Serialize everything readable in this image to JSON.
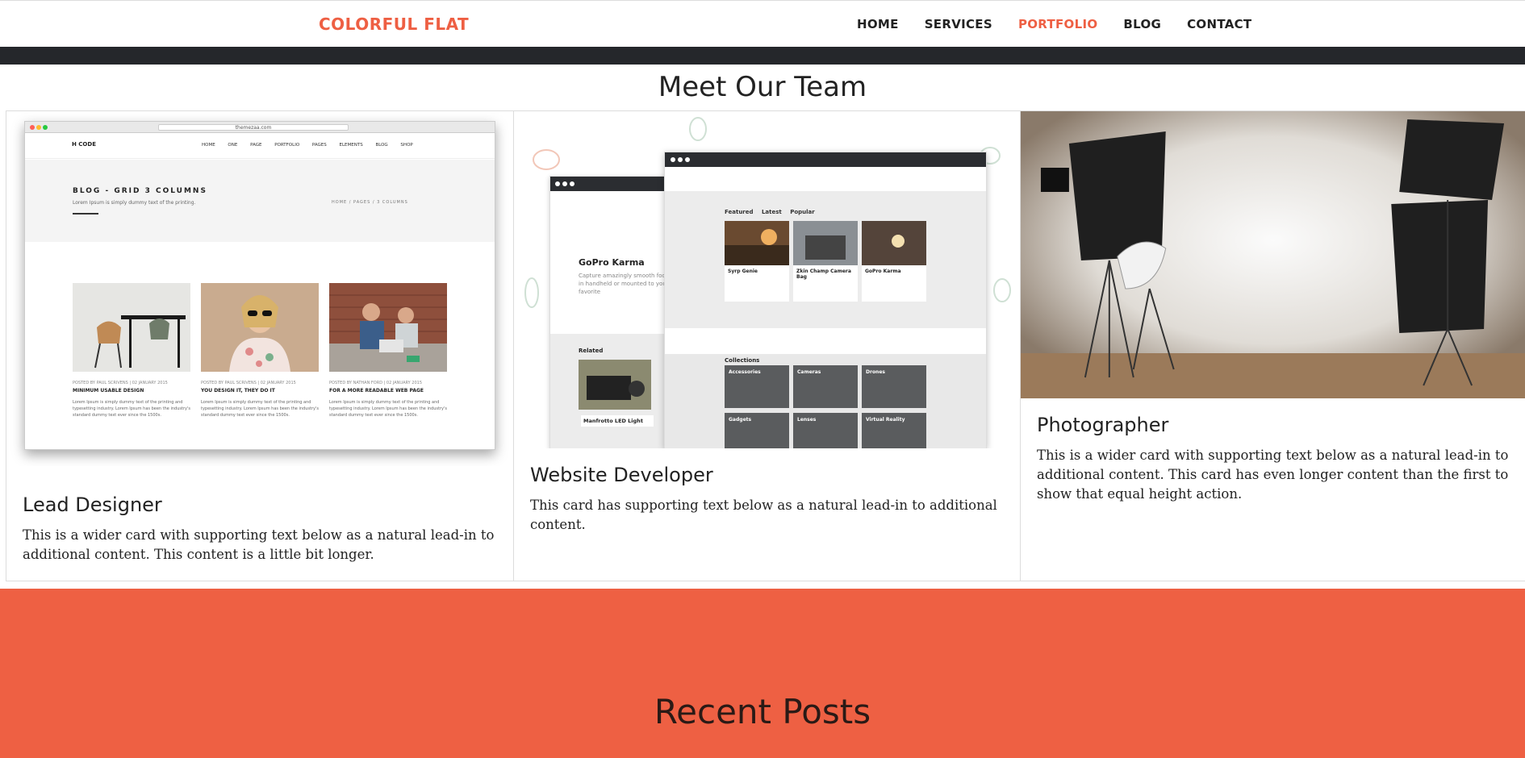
{
  "brand": "COLORFUL FLAT",
  "nav": {
    "items": [
      {
        "label": "HOME"
      },
      {
        "label": "SERVICES"
      },
      {
        "label": "PORTFOLIO"
      },
      {
        "label": "BLOG"
      },
      {
        "label": "CONTACT"
      }
    ],
    "active": "PORTFOLIO"
  },
  "team": {
    "title": "Meet Our Team",
    "cards": [
      {
        "title": "Lead Designer",
        "text": "This is a wider card with supporting text below as a natural lead-in to additional content. This content is a little bit longer."
      },
      {
        "title": "Website Developer",
        "text": "This card has supporting text below as a natural lead-in to additional content."
      },
      {
        "title": "Photographer",
        "text": "This is a wider card with supporting text below as a natural lead-in to additional content. This card has even longer content than the first to show that equal height action."
      }
    ]
  },
  "mock_blog": {
    "url": "themezaa.com",
    "logo": "H CODE",
    "menu": "HOME ONE PAGE PORTFOLIO PAGES ELEMENTS BLOG SHOP",
    "hero_title": "BLOG - GRID 3 COLUMNS",
    "hero_sub": "Lorem Ipsum is simply dummy text of the printing.",
    "crumb": "HOME / PAGES / 3 COLUMNS",
    "posts": [
      {
        "meta": "POSTED BY PAUL SCRIVENS | 02 JANUARY 2015",
        "title": "MINIMUM USABLE DESIGN"
      },
      {
        "meta": "POSTED BY PAUL SCRIVENS | 02 JANUARY 2015",
        "title": "YOU DESIGN IT, THEY DO IT"
      },
      {
        "meta": "POSTED BY NATHAN FORD | 02 JANUARY 2015",
        "title": "FOR A MORE READABLE WEB PAGE"
      }
    ],
    "post_text": "Lorem Ipsum is simply dummy text of the printing and typesetting industry. Lorem Ipsum has been the industry's standard dummy text ever since the 1500s."
  },
  "mock_app": {
    "product": "GoPro Karma",
    "product_desc": "Capture amazingly smooth footage in handheld or mounted to your favorite",
    "related": "Related",
    "related_item": "Manfrotto LED Light",
    "tabs": [
      "Featured",
      "Latest",
      "Popular"
    ],
    "thumbs": [
      "Syrp Genie",
      "Zkin Champ Camera Bag",
      "GoPro Karma"
    ],
    "collections_label": "Collections",
    "collections": [
      "Accessories",
      "Cameras",
      "Drones",
      "Gadgets",
      "Lenses",
      "Virtual Reality"
    ]
  },
  "recent": {
    "title": "Recent Posts"
  },
  "colors": {
    "accent": "#ee5f43",
    "dark_bar": "#25272b",
    "recent_bg": "#ee6043"
  }
}
